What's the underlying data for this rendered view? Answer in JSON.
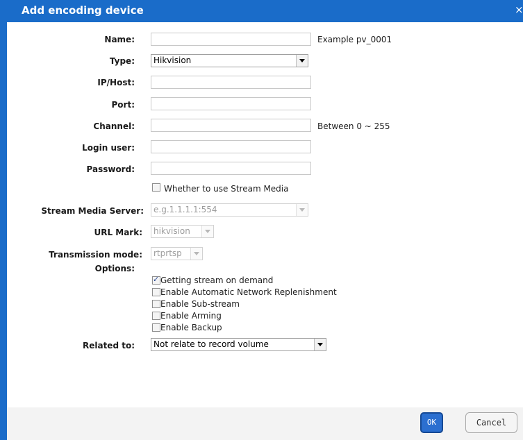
{
  "dialog": {
    "title": "Add encoding device",
    "close_glyph": "×"
  },
  "form": {
    "name": {
      "label": "Name:",
      "value": "",
      "hint": "Example pv_0001"
    },
    "type": {
      "label": "Type:",
      "value": "Hikvision"
    },
    "ip_host": {
      "label": "IP/Host:",
      "value": ""
    },
    "port": {
      "label": "Port:",
      "value": ""
    },
    "channel": {
      "label": "Channel:",
      "value": "",
      "hint": "Between 0 ~ 255"
    },
    "login_user": {
      "label": "Login user:",
      "value": ""
    },
    "password": {
      "label": "Password:",
      "value": ""
    },
    "use_stream_media": {
      "label": "Whether to use Stream Media",
      "checked": false
    },
    "stream_media_server": {
      "label": "Stream Media Server:",
      "placeholder": "e.g.1.1.1.1:554"
    },
    "url_mark": {
      "label": "URL Mark:",
      "value": "hikvision"
    },
    "transmission_mode": {
      "label": "Transmission mode:",
      "value": "rtprtsp"
    },
    "options": {
      "label": "Options:",
      "items": [
        {
          "label": "Getting stream on demand",
          "checked": true
        },
        {
          "label": "Enable Automatic Network Replenishment",
          "checked": false
        },
        {
          "label": "Enable Sub-stream",
          "checked": false
        },
        {
          "label": "Enable Arming",
          "checked": false
        },
        {
          "label": "Enable Backup",
          "checked": false
        }
      ]
    },
    "related_to": {
      "label": "Related to:",
      "value": "Not relate to record volume"
    }
  },
  "footer": {
    "ok_label": "OK",
    "cancel_label": "Cancel"
  },
  "colors": {
    "title_bar": "#1a6cc9",
    "ok_button": "#2b6fd0"
  }
}
